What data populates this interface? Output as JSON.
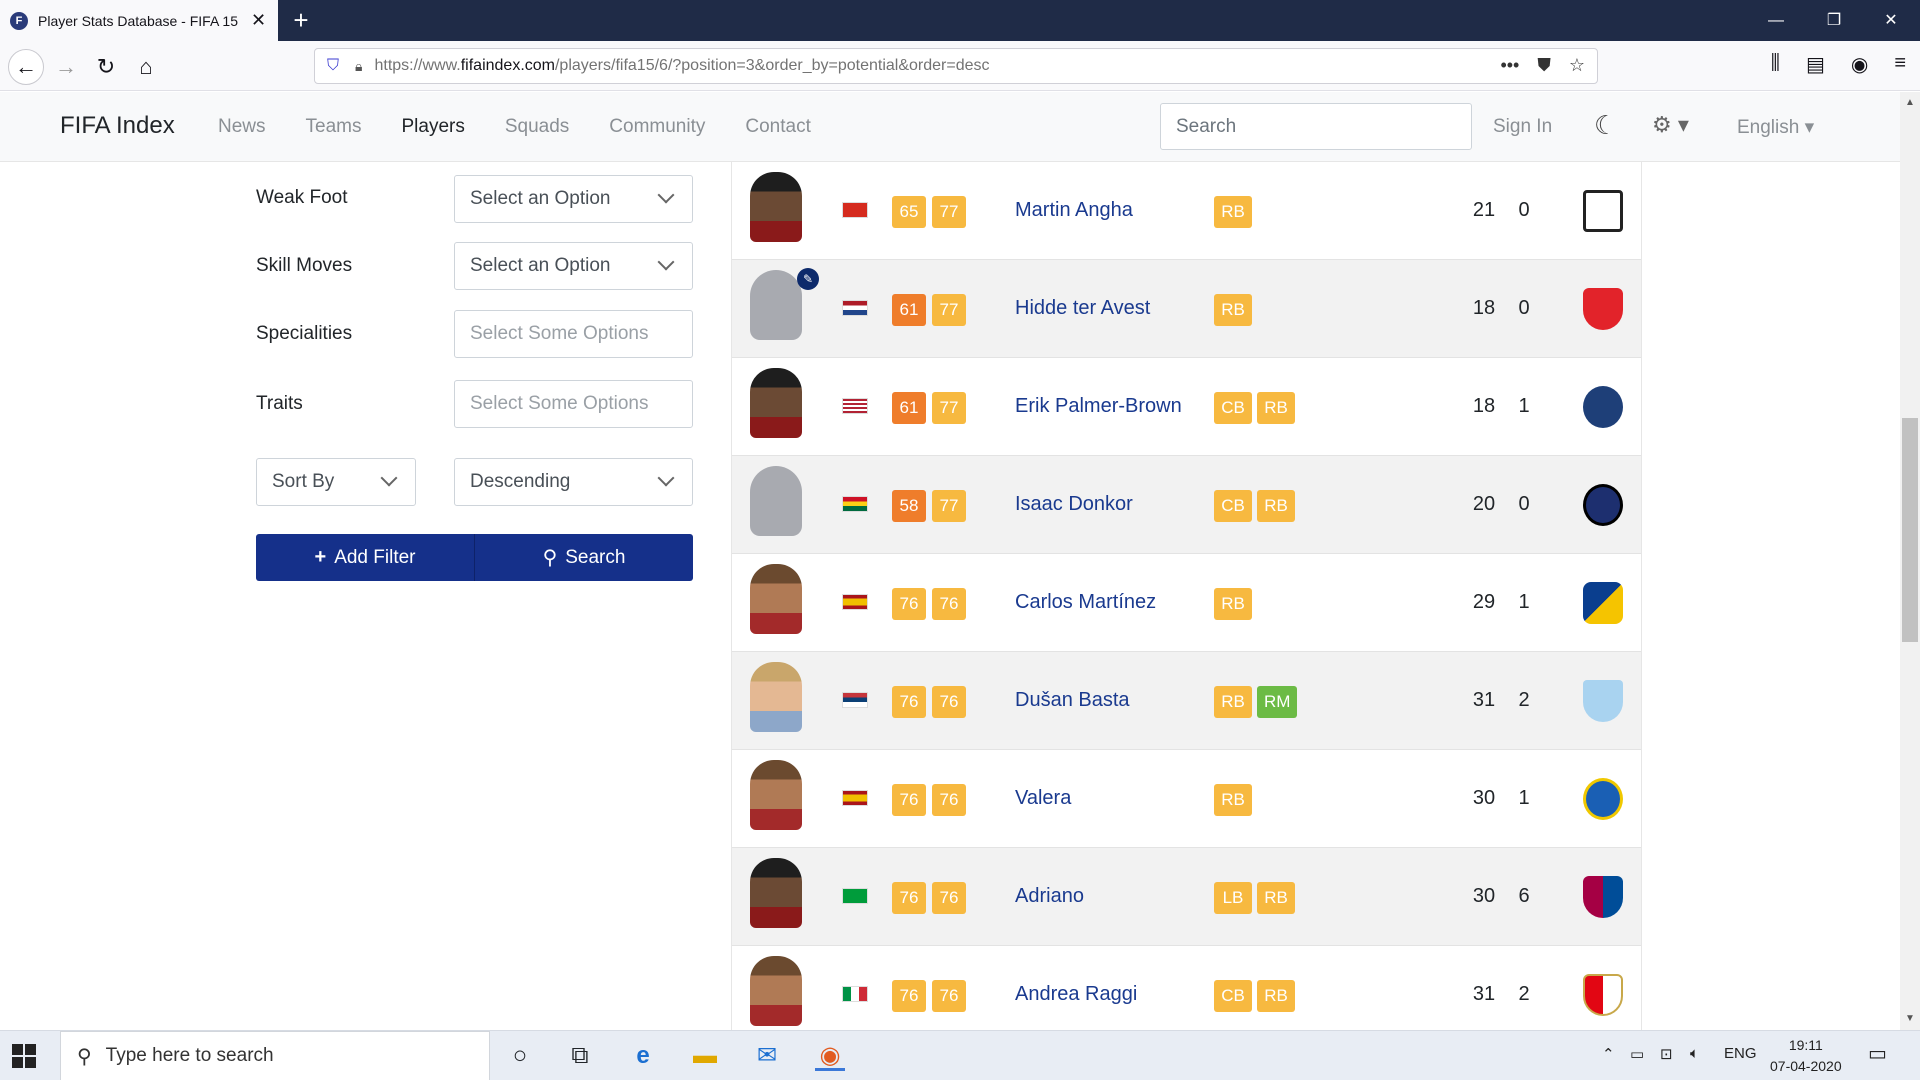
{
  "browser": {
    "tab_title": "Player Stats Database - FIFA 15",
    "tab_favicon_letter": "F",
    "url_prefix": "https://www.",
    "url_host": "fifaindex.com",
    "url_path": "/players/fifa15/6/?position=3&order_by=potential&order=desc"
  },
  "site": {
    "brand": "FIFA Index",
    "nav": [
      "News",
      "Teams",
      "Players",
      "Squads",
      "Community",
      "Contact"
    ],
    "active_nav": "Players",
    "search_placeholder": "Search",
    "sign_in": "Sign In",
    "language": "English"
  },
  "filters": {
    "weak_foot": {
      "label": "Weak Foot",
      "value": "Select an Option"
    },
    "skill_moves": {
      "label": "Skill Moves",
      "value": "Select an Option"
    },
    "specialities": {
      "label": "Specialities",
      "value": "Select Some Options"
    },
    "traits": {
      "label": "Traits",
      "value": "Select Some Options"
    },
    "sort_by": "Sort By",
    "order": "Descending",
    "add_filter": "Add Filter",
    "search": "Search"
  },
  "colors": {
    "primary_button": "#15308a",
    "rating_orange": "#ef7d2b",
    "rating_gold": "#f7b940",
    "pos_green": "#6cbb45",
    "link_blue": "#1a3a8f"
  },
  "players": [
    {
      "name": "Martin Angha",
      "ovr": "65",
      "pot": "77",
      "positions": [
        "RB"
      ],
      "age": "21",
      "hits": "0",
      "face": "dark",
      "flag": "switzerland",
      "club": "1860-munich"
    },
    {
      "name": "Hidde ter Avest",
      "ovr": "61",
      "pot": "77",
      "positions": [
        "RB"
      ],
      "age": "18",
      "hits": "0",
      "face": "silhouette",
      "flag": "netherlands",
      "club": "fc-twente"
    },
    {
      "name": "Erik Palmer-Brown",
      "ovr": "61",
      "pot": "77",
      "positions": [
        "CB",
        "RB"
      ],
      "age": "18",
      "hits": "1",
      "face": "dark",
      "flag": "usa",
      "club": "sporting-kc"
    },
    {
      "name": "Isaac Donkor",
      "ovr": "58",
      "pot": "77",
      "positions": [
        "CB",
        "RB"
      ],
      "age": "20",
      "hits": "0",
      "face": "silhouette",
      "flag": "ghana",
      "club": "inter"
    },
    {
      "name": "Carlos Martínez",
      "ovr": "76",
      "pot": "76",
      "positions": [
        "RB"
      ],
      "age": "29",
      "hits": "1",
      "face": "photo",
      "flag": "spain",
      "club": "real-sociedad"
    },
    {
      "name": "Dušan Basta",
      "ovr": "76",
      "pot": "76",
      "positions": [
        "RB",
        "RM"
      ],
      "age": "31",
      "hits": "2",
      "face": "light",
      "flag": "serbia",
      "club": "lazio"
    },
    {
      "name": "Valera",
      "ovr": "76",
      "pot": "76",
      "positions": [
        "RB"
      ],
      "age": "30",
      "hits": "1",
      "face": "photo",
      "flag": "spain",
      "club": "getafe"
    },
    {
      "name": "Adriano",
      "ovr": "76",
      "pot": "76",
      "positions": [
        "LB",
        "RB"
      ],
      "age": "30",
      "hits": "6",
      "face": "dark",
      "flag": "brazil",
      "club": "barcelona"
    },
    {
      "name": "Andrea Raggi",
      "ovr": "76",
      "pot": "76",
      "positions": [
        "CB",
        "RB"
      ],
      "age": "31",
      "hits": "2",
      "face": "photo",
      "flag": "italy",
      "club": "monaco"
    }
  ],
  "taskbar": {
    "search_placeholder": "Type here to search",
    "lang": "ENG",
    "time": "19:11",
    "date": "07-04-2020"
  }
}
